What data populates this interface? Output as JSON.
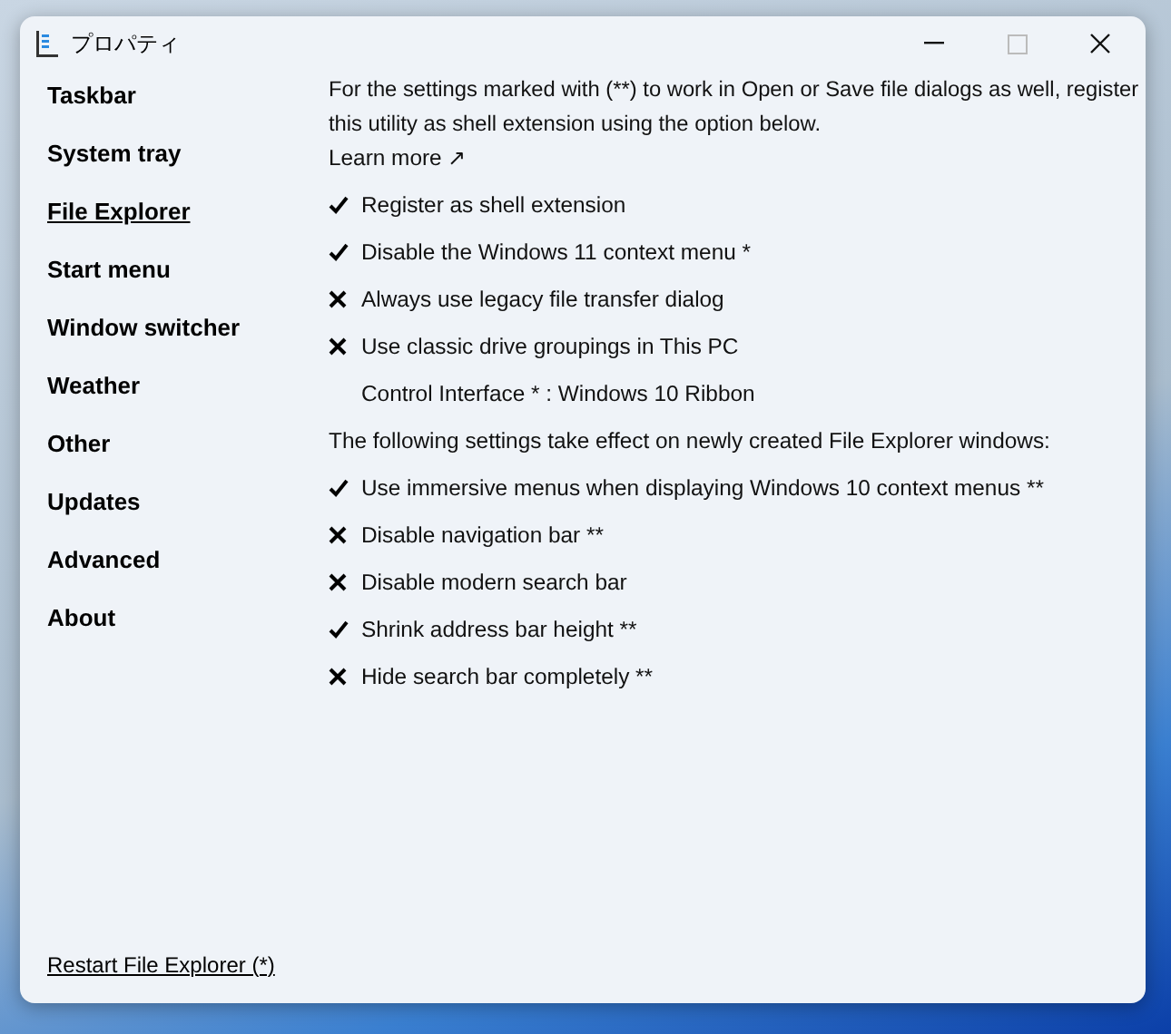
{
  "window": {
    "title": "プロパティ"
  },
  "sidebar": {
    "items": [
      {
        "label": "Taskbar",
        "selected": false
      },
      {
        "label": "System tray",
        "selected": false
      },
      {
        "label": "File Explorer",
        "selected": true
      },
      {
        "label": "Start menu",
        "selected": false
      },
      {
        "label": "Window switcher",
        "selected": false
      },
      {
        "label": "Weather",
        "selected": false
      },
      {
        "label": "Other",
        "selected": false
      },
      {
        "label": "Updates",
        "selected": false
      },
      {
        "label": "Advanced",
        "selected": false
      },
      {
        "label": "About",
        "selected": false
      }
    ],
    "footer_link": "Restart File Explorer (*)"
  },
  "content": {
    "intro": "For the settings marked with (**) to work in Open or Save file dialogs as well, register this utility as shell extension using the option below.",
    "learn_more": "Learn more ↗",
    "items": [
      {
        "kind": "toggle",
        "label": "Register as shell extension",
        "checked": true
      },
      {
        "kind": "toggle",
        "label": "Disable the Windows 11 context menu *",
        "checked": true
      },
      {
        "kind": "toggle",
        "label": "Always use legacy file transfer dialog",
        "checked": false
      },
      {
        "kind": "toggle",
        "label": "Use classic drive groupings in This PC",
        "checked": false
      },
      {
        "kind": "option",
        "label": "Control Interface * : Windows 10 Ribbon"
      },
      {
        "kind": "heading",
        "label": "The following settings take effect on newly created File Explorer windows:"
      },
      {
        "kind": "toggle",
        "label": "Use immersive menus when displaying Windows 10 context menus **",
        "checked": true
      },
      {
        "kind": "toggle",
        "label": "Disable navigation bar **",
        "checked": false
      },
      {
        "kind": "toggle",
        "label": "Disable modern search bar",
        "checked": false
      },
      {
        "kind": "toggle",
        "label": "Shrink address bar height **",
        "checked": true
      },
      {
        "kind": "toggle",
        "label": "Hide search bar completely **",
        "checked": false
      }
    ]
  }
}
